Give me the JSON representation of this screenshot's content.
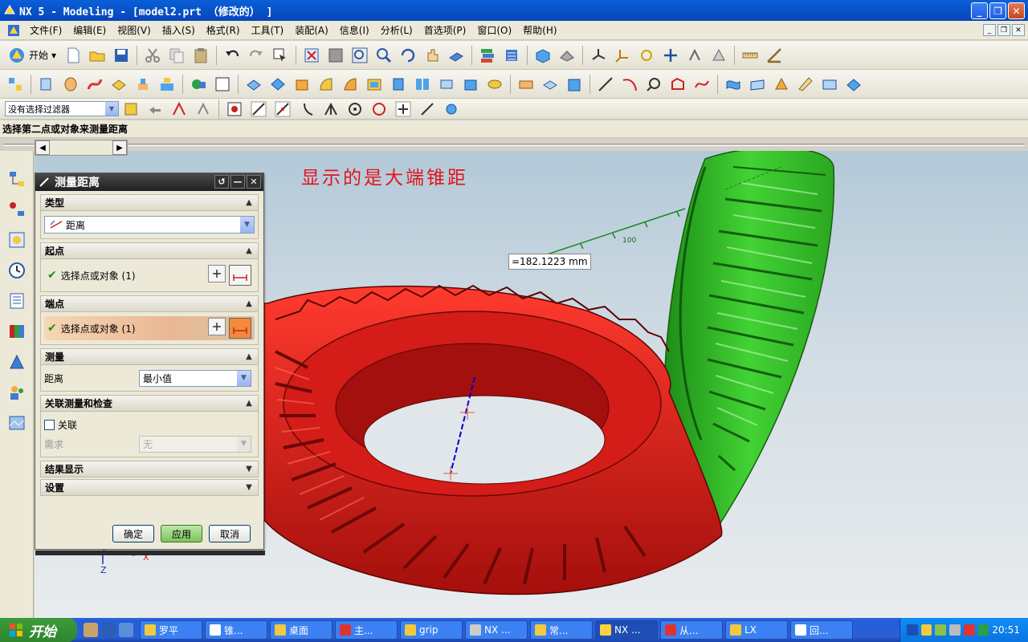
{
  "window": {
    "title": "NX 5 - Modeling - [model2.prt （修改的） ]"
  },
  "menu": [
    "文件(F)",
    "编辑(E)",
    "视图(V)",
    "插入(S)",
    "格式(R)",
    "工具(T)",
    "装配(A)",
    "信息(I)",
    "分析(L)",
    "首选项(P)",
    "窗口(O)",
    "帮助(H)"
  ],
  "toolbar": {
    "start_label": "开始",
    "filter_value": "没有选择过滤器"
  },
  "status": {
    "prompt": "选择第二点或对象来测量距离"
  },
  "viewport": {
    "annotation": "显示的是大端锥距",
    "measure_value": "=182.1223 mm",
    "ruler_tick": "100",
    "axis_x": "X",
    "axis_z": "Z",
    "colors": {
      "red_gear": "#e8211e",
      "green_gear": "#3ccf2e",
      "measure_line": "#0000c8"
    }
  },
  "dialog": {
    "title": "测量距离",
    "sections": {
      "type": {
        "title": "类型",
        "value": "距离"
      },
      "start": {
        "title": "起点",
        "select_label": "选择点或对象 (1)"
      },
      "end": {
        "title": "端点",
        "select_label": "选择点或对象 (1)"
      },
      "measure": {
        "title": "测量",
        "label": "距离",
        "value": "最小值"
      },
      "assoc": {
        "title": "关联测量和检查",
        "checkbox_label": "关联",
        "req_label": "需求",
        "req_value": "无"
      },
      "result": {
        "title": "结果显示"
      },
      "settings": {
        "title": "设置"
      }
    },
    "buttons": {
      "ok": "确定",
      "apply": "应用",
      "cancel": "取消"
    }
  },
  "taskbar": {
    "start_label": "开始",
    "tasks": [
      "罗平",
      "锥...",
      "桌面",
      "主...",
      "grip",
      "NX ...",
      "常...",
      "NX ...",
      "从...",
      "LX",
      "回..."
    ],
    "clock": "20:51"
  }
}
